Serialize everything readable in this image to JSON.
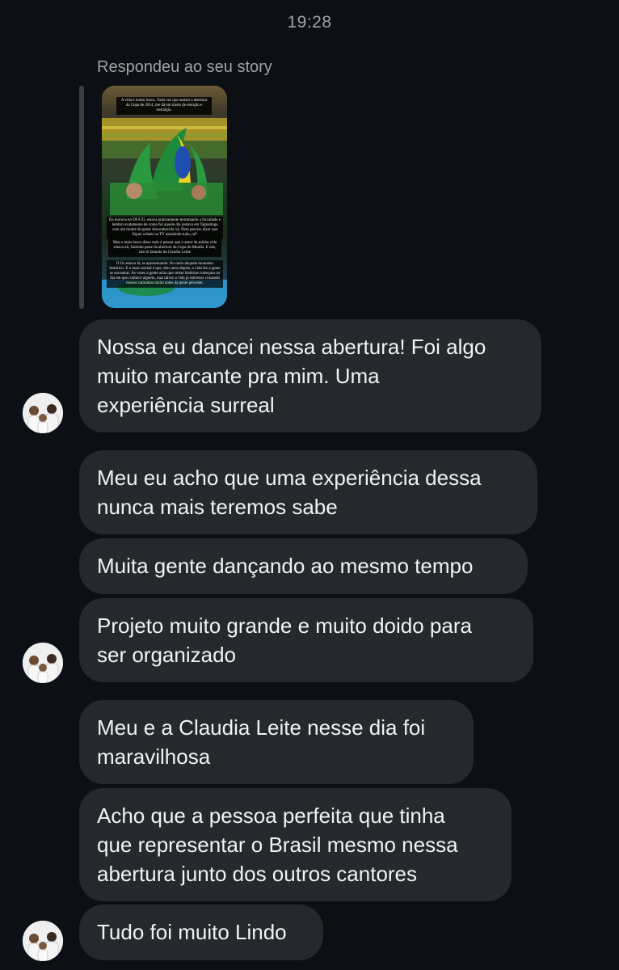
{
  "timestamp": "19:28",
  "story_reply": {
    "label": "Respondeu ao seu story",
    "caption_lines": [
      "A vida é muito louca.\nToda vez que assisto a abertura da Copa de 2014, me dá um misto de emoção e nostalgia.",
      "Eu morava no DF/GO, estava praticamente terminando a faculdade e lembro exatamente de como foi aquele dia (estava em Taguatinga com um monte de gente desconhecida rs). Nem preciso dizer que fiquei colado na TV assistindo tudo, né?",
      "Mas o mais louco disso tudo é pensar que o amor da minha vida estava ali, fazendo parte da abertura da Copa do Mundo.\nE não, não tô falando da Claudia Leitte",
      "O Ge estava lá, se apresentando. No meio daquele momento histórico. E o mais surreal é que, dois anos depois, a vida fez a gente se encontrar.\nÀs vezes a gente acha que certas histórias começam no dia em que conhece alguém, mas talvez a vida já estivesse cruzando nossos caminhos muito antes da gente perceber."
    ]
  },
  "messages": [
    {
      "text": "Nossa eu dancei nessa abertura! Foi algo\nmuito marcante pra mim. Uma\nexperiência surreal"
    },
    {
      "text": "Meu eu acho que uma experiência dessa\nnunca mais teremos sabe"
    },
    {
      "text": "Muita gente dançando ao mesmo tempo"
    },
    {
      "text": "Projeto muito grande e muito doido para\nser organizado"
    },
    {
      "text": "Meu e a Claudia Leite nesse dia foi\nmaravilhosa"
    },
    {
      "text": "Acho que a pessoa perfeita que tinha\nque representar o Brasil mesmo nessa\nabertura junto dos outros cantores"
    },
    {
      "text": "Tudo foi muito Lindo"
    }
  ],
  "icons": {
    "avatar": "family-photo-avatar"
  },
  "colors": {
    "background": "#0c1014",
    "bubble": "#25292e",
    "text": "#f2f2f2",
    "muted_text": "#9ea3a8"
  }
}
